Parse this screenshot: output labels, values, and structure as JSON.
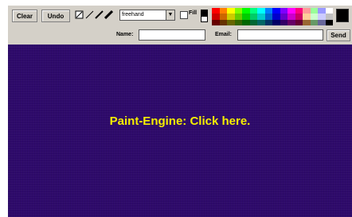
{
  "toolbar": {
    "clear_label": "Clear",
    "undo_label": "Undo",
    "brush_value": "freehand",
    "fill_label": "Fill",
    "send_label": "Send",
    "tools": [
      "rectangle-outline-icon",
      "line-icon",
      "marker-icon",
      "brush-icon"
    ],
    "preview_colors": [
      "#000000",
      "#ffffff"
    ],
    "current_color": "#000000",
    "palette": [
      "#ff0000",
      "#ff7f00",
      "#ffff00",
      "#7fff00",
      "#00ff00",
      "#00ff7f",
      "#00ffff",
      "#007fff",
      "#0000ff",
      "#7f00ff",
      "#ff00ff",
      "#ff007f",
      "#ff9999",
      "#99ff99",
      "#9999ff",
      "#ffffff",
      "#cc0000",
      "#cc6600",
      "#cccc00",
      "#66cc00",
      "#00cc00",
      "#00cc66",
      "#00cccc",
      "#0066cc",
      "#0000cc",
      "#6600cc",
      "#cc00cc",
      "#cc0066",
      "#ffcc99",
      "#ccffcc",
      "#ccccff",
      "#c0c0c0",
      "#660000",
      "#663300",
      "#666600",
      "#336600",
      "#006600",
      "#006633",
      "#006666",
      "#003366",
      "#000066",
      "#330066",
      "#660066",
      "#660033",
      "#996633",
      "#669966",
      "#666699",
      "#000000"
    ]
  },
  "form": {
    "name_label": "Name:",
    "email_label": "Email:",
    "name_value": "",
    "email_value": ""
  },
  "canvas": {
    "prompt": "Paint-Engine: Click here.",
    "background": "#2e0a6b",
    "text_color": "#f5ee00"
  }
}
